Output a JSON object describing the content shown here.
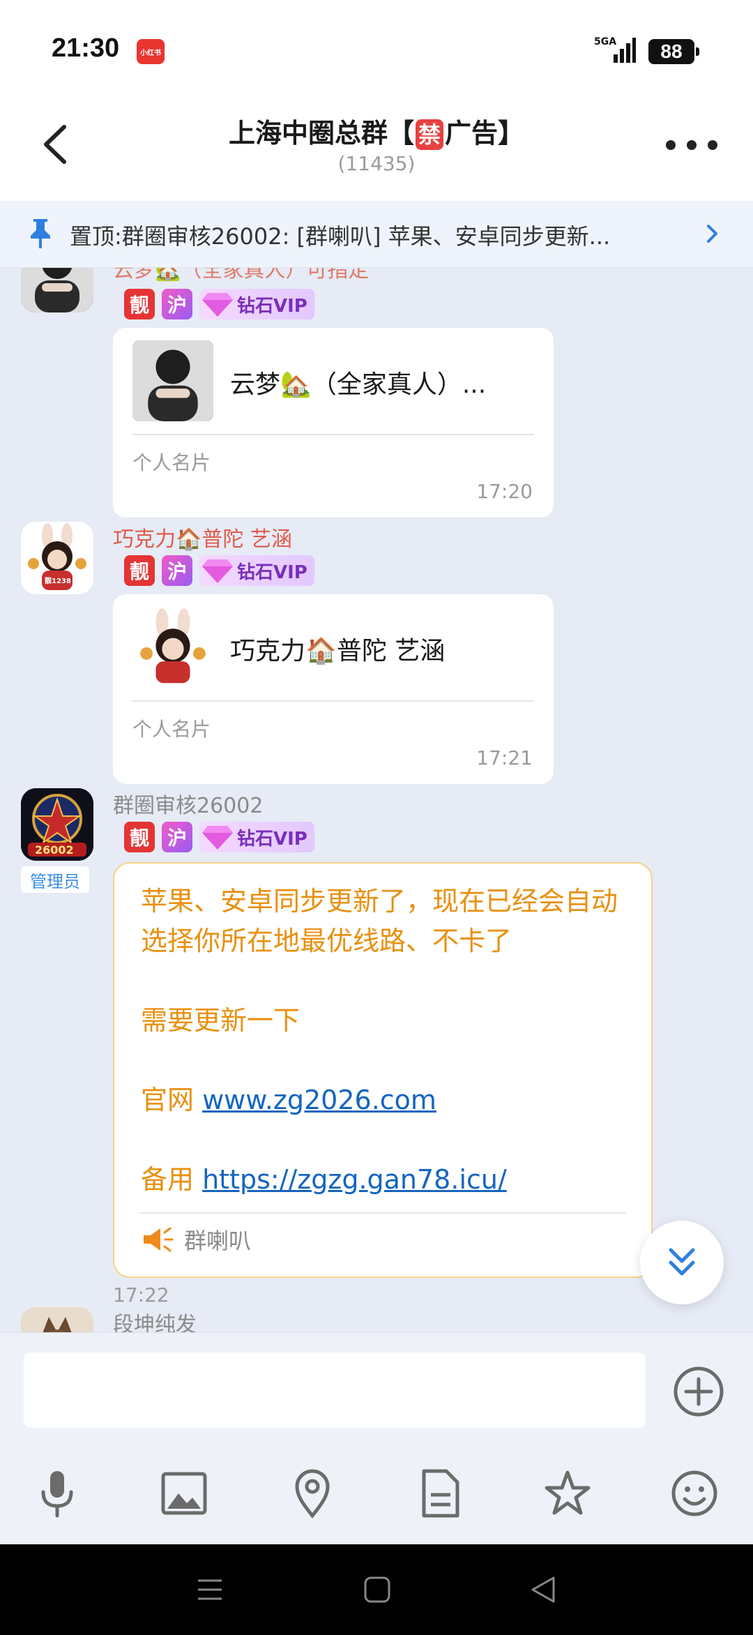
{
  "status_bar": {
    "time": "21:30",
    "app_icon_label": "小红书",
    "network": "5GA",
    "battery": "88"
  },
  "header": {
    "title_prefix": "上海中圈总群【",
    "title_ban": "禁",
    "title_suffix": "广告】",
    "member_count": "(11435)"
  },
  "pinned": {
    "text": "置顶:群圈审核26002: [群喇叭] 苹果、安卓同步更新..."
  },
  "badges": {
    "liang": "靓",
    "hu": "沪",
    "vip": "钻石VIP"
  },
  "messages": [
    {
      "sender": "云梦🏡（全家真人）可指定",
      "card_name": "云梦🏡（全家真人）...",
      "card_type": "个人名片",
      "time": "17:20"
    },
    {
      "sender": "巧克力🏠普陀 艺涵",
      "card_name": "巧克力🏠普陀 艺涵",
      "card_type": "个人名片",
      "time": "17:21",
      "avatar_label": "靓1238"
    },
    {
      "sender": "群圈审核26002",
      "role": "管理员",
      "avatar_label": "26002",
      "lines": [
        "苹果、安卓同步更新了，现在已经会自动选择你所在地最优线路、不卡了",
        "",
        "需要更新一下",
        "",
        "官网 ",
        "",
        "备用 "
      ],
      "official_link": "www.zg2026.com",
      "backup_link": "https://zgzg.gan78.icu/",
      "footer_label": "群喇叭",
      "time": "17:22"
    },
    {
      "sender": "段坤纯发"
    }
  ],
  "input": {
    "placeholder": ""
  },
  "colors": {
    "accent": "#3A8EE6",
    "notice_text": "#E8900E",
    "link": "#1565C0",
    "chat_bg": "#E6EBF5"
  }
}
